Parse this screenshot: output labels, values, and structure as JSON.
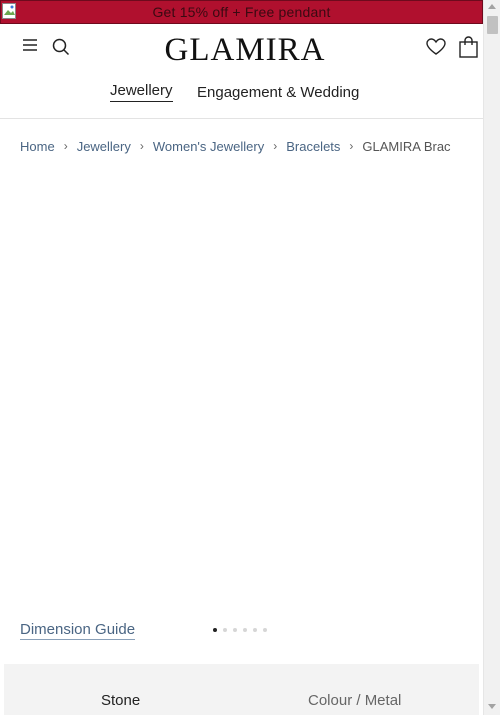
{
  "promo": {
    "text": "Get 15% off + Free pendant",
    "background": "#b0102e"
  },
  "header": {
    "logo": "GLAMIRA",
    "icons": [
      "menu-icon",
      "search-icon",
      "heart-icon",
      "shopping-bag-icon"
    ],
    "nav_tabs": [
      {
        "label": "Jewellery",
        "active": true
      },
      {
        "label": "Engagement & Wedding",
        "active": false
      }
    ]
  },
  "breadcrumb": {
    "items": [
      "Home",
      "Jewellery",
      "Women's Jewellery",
      "Bracelets",
      "GLAMIRA Brac"
    ],
    "separator_icon": "chevron-right-icon"
  },
  "gallery": {
    "dimension_guide": "Dimension Guide",
    "slide_count": 6,
    "active_slide": 1
  },
  "options": {
    "stone_label": "Stone",
    "metal_label": "Colour / Metal"
  }
}
